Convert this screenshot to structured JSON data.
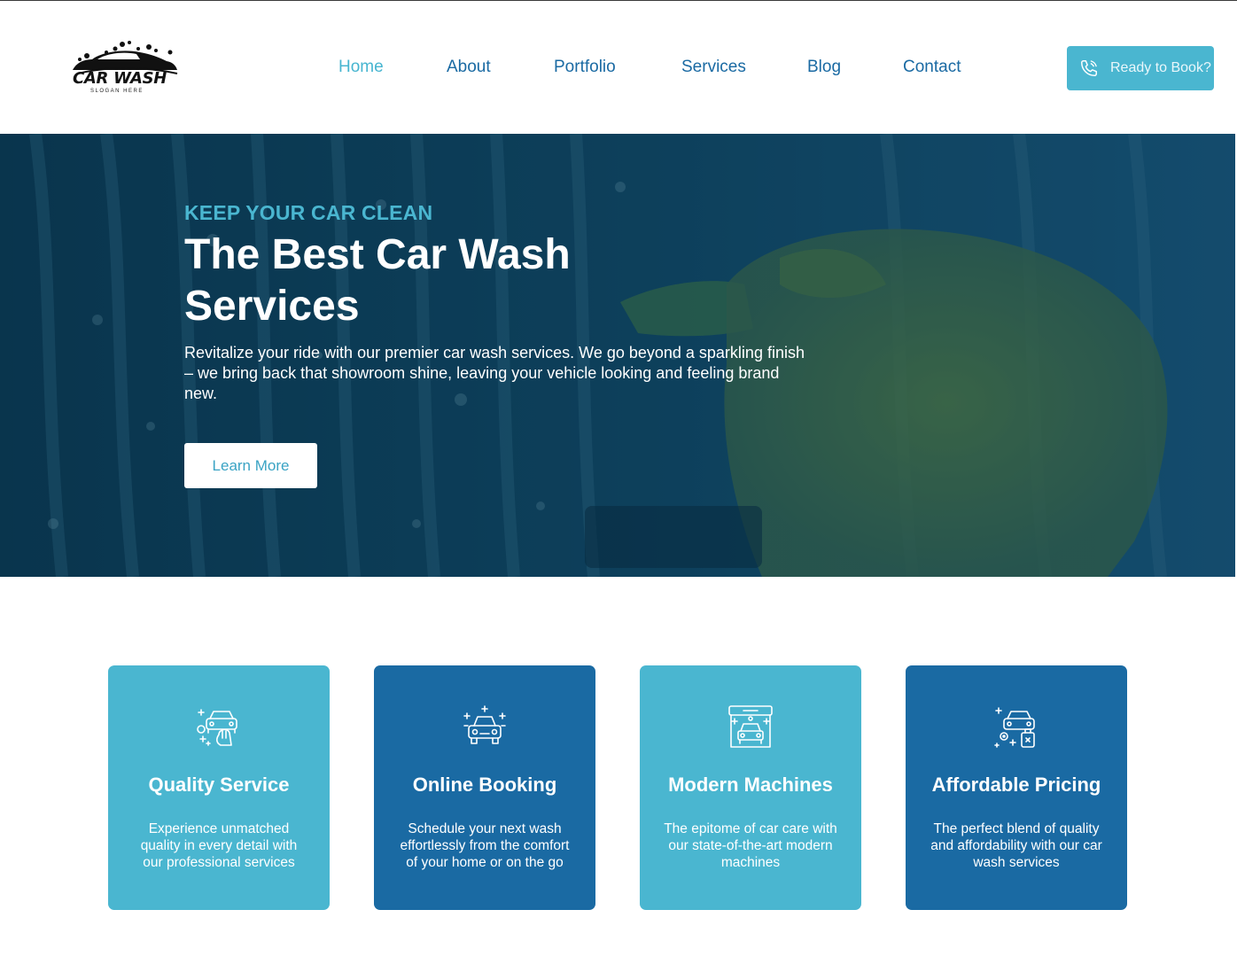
{
  "brand": {
    "name": "CAR WASH",
    "slogan": "SLOGAN HERE"
  },
  "nav": {
    "items": [
      {
        "label": "Home",
        "active": true
      },
      {
        "label": "About",
        "active": false
      },
      {
        "label": "Portfolio",
        "active": false
      },
      {
        "label": "Services",
        "active": false
      },
      {
        "label": "Blog",
        "active": false
      },
      {
        "label": "Contact",
        "active": false
      }
    ],
    "cta_label": "Ready to Book?",
    "cta_icon": "phone-icon"
  },
  "hero": {
    "kicker": "KEEP YOUR CAR CLEAN",
    "title": "The Best Car Wash Services",
    "description": "Revitalize your ride with our premier car wash services. We go beyond a sparkling finish – we bring back that showroom shine, leaving your vehicle looking and feeling brand new.",
    "button_label": "Learn More"
  },
  "features": [
    {
      "title": "Quality Service",
      "text": "Experience unmatched quality in every detail with our professional services",
      "icon": "car-hand-wash-icon",
      "color": "#4ab6d0"
    },
    {
      "title": "Online Booking",
      "text": "Schedule your next wash effortlessly from the comfort of your home or on the go",
      "icon": "sparkling-car-icon",
      "color": "#1a6aa3"
    },
    {
      "title": "Modern Machines",
      "text": "The epitome of car care with our state-of-the-art modern machines",
      "icon": "car-wash-machine-icon",
      "color": "#4ab6d0"
    },
    {
      "title": "Affordable Pricing",
      "text": "The perfect blend of quality and affordability with our car wash services",
      "icon": "car-shampoo-icon",
      "color": "#1a6aa3"
    }
  ],
  "colors": {
    "accent_light": "#4ab6d0",
    "accent_dark": "#1a6aa3"
  }
}
